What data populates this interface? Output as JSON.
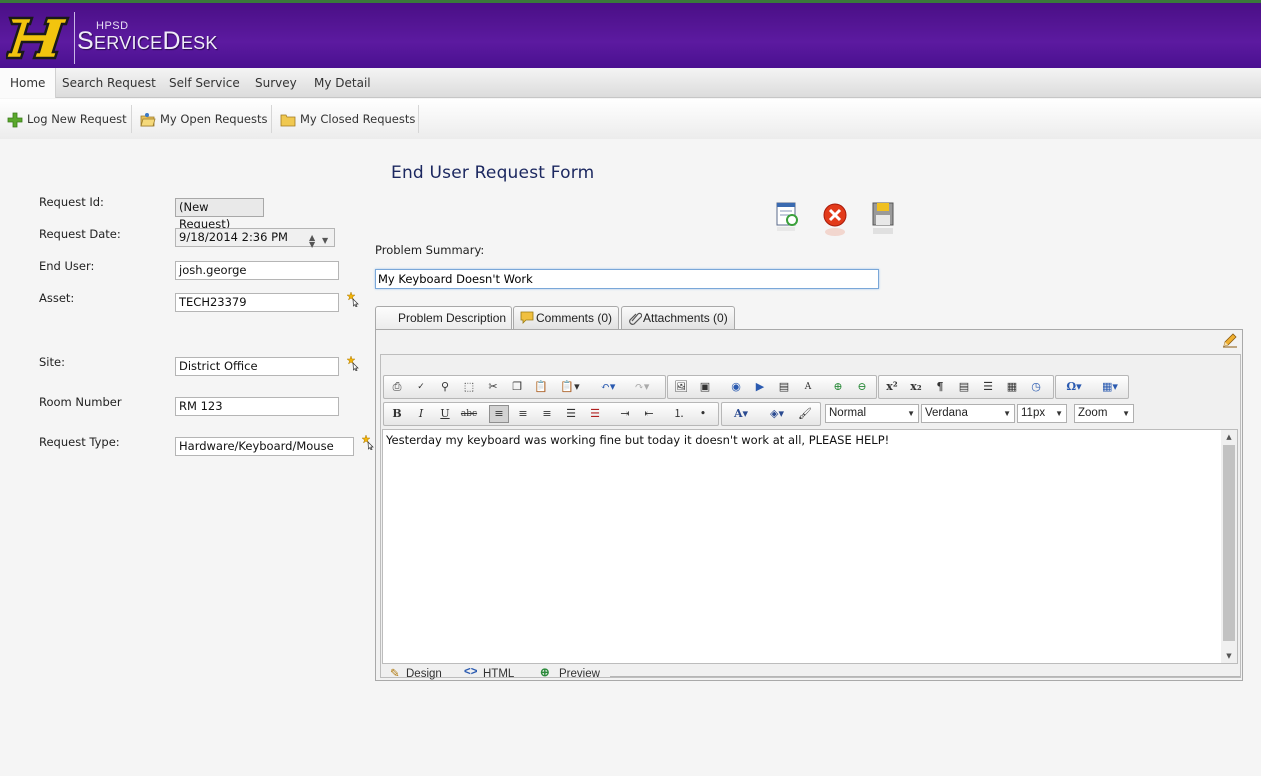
{
  "app": {
    "brand_small": "HPSD",
    "brand_big": "ServiceDesk"
  },
  "menu": [
    {
      "label": "Home"
    },
    {
      "label": "Search Request"
    },
    {
      "label": "Self Service"
    },
    {
      "label": "Survey"
    },
    {
      "label": "My Detail"
    }
  ],
  "subtoolbar": [
    {
      "label": "Log New Request",
      "icon": "plus-icon"
    },
    {
      "label": "My Open Requests",
      "icon": "open-folder-icon"
    },
    {
      "label": "My Closed Requests",
      "icon": "folder-icon"
    }
  ],
  "form": {
    "title": "End User Request Form",
    "labels": {
      "request_id": "Request Id:",
      "request_date": "Request Date:",
      "end_user": "End User:",
      "asset": "Asset:",
      "site": "Site:",
      "room_number": "Room Number",
      "request_type": "Request Type:"
    },
    "values": {
      "request_id": "(New Request)",
      "request_date": "9/18/2014 2:36 PM",
      "end_user": "josh.george",
      "asset": "TECH23379",
      "site": "District Office",
      "room_number": "RM 123",
      "request_type": "Hardware/Keyboard/Mouse"
    },
    "problem_summary_label": "Problem Summary:",
    "problem_summary_value": "My Keyboard Doesn't Work"
  },
  "tabs": [
    {
      "label": "Problem Description"
    },
    {
      "label": "Comments (0)"
    },
    {
      "label": "Attachments (0)"
    }
  ],
  "editor": {
    "format_value": "Normal",
    "font_value": "Verdana",
    "size_value": "11px",
    "zoom_value": "Zoom",
    "content": "Yesterday my keyboard was working fine but today it doesn't work at all, PLEASE HELP!",
    "modes": [
      {
        "label": "Design"
      },
      {
        "label": "HTML"
      },
      {
        "label": "Preview"
      }
    ]
  },
  "colors": {
    "header": "#4f1294",
    "title": "#1c2860",
    "logo_gold": "#f2c40e"
  }
}
